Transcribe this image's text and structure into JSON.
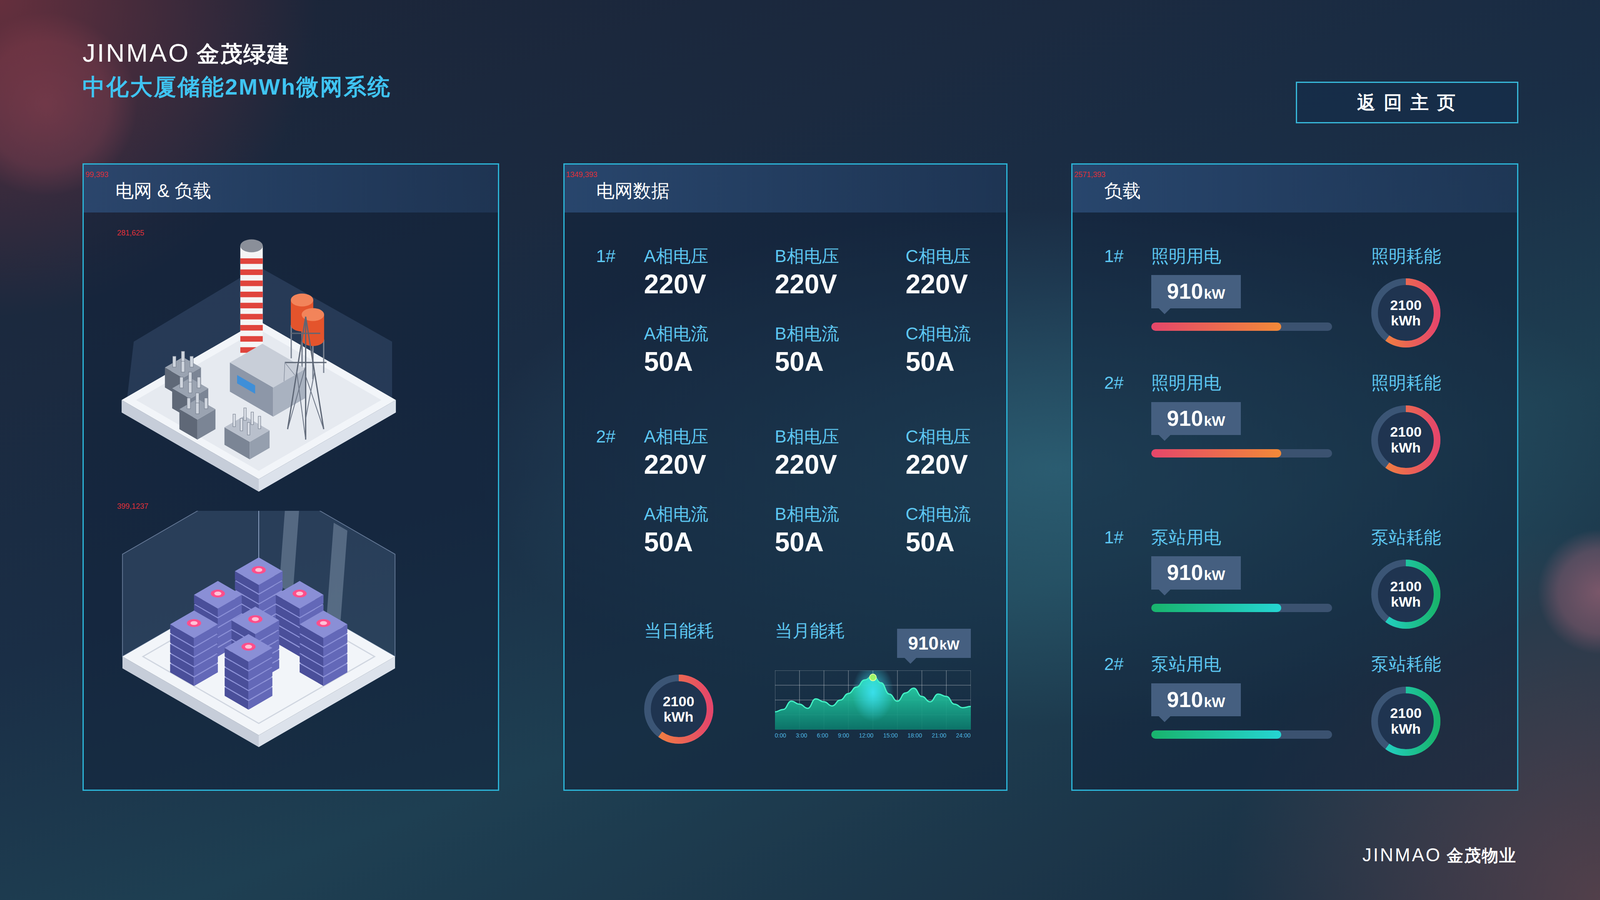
{
  "header": {
    "logo": {
      "brand": "JINMAO",
      "name": "金茂绿建"
    },
    "title": "中化大厦储能2MWh微网系统",
    "home_button": "返 回 主 页"
  },
  "panels": {
    "grid_load": {
      "title": "电网 & 负载",
      "annotation": "99,393",
      "figures": [
        {
          "kind": "substation",
          "annotation": "281,625"
        },
        {
          "kind": "battery",
          "annotation": "399,1237"
        }
      ]
    },
    "grid_data": {
      "title": "电网数据",
      "annotation": "1349,393",
      "groups": [
        {
          "id": "1#",
          "metrics": [
            {
              "label": "A相电压",
              "value": "220V"
            },
            {
              "label": "B相电压",
              "value": "220V"
            },
            {
              "label": "C相电压",
              "value": "220V"
            },
            {
              "label": "A相电流",
              "value": "50A"
            },
            {
              "label": "B相电流",
              "value": "50A"
            },
            {
              "label": "C相电流",
              "value": "50A"
            }
          ]
        },
        {
          "id": "2#",
          "metrics": [
            {
              "label": "A相电压",
              "value": "220V"
            },
            {
              "label": "B相电压",
              "value": "220V"
            },
            {
              "label": "C相电压",
              "value": "220V"
            },
            {
              "label": "A相电流",
              "value": "50A"
            },
            {
              "label": "B相电流",
              "value": "50A"
            },
            {
              "label": "C相电流",
              "value": "50A"
            }
          ]
        }
      ],
      "daily": {
        "label": "当日能耗",
        "value": "2100",
        "unit": "kWh",
        "level": 0.6
      },
      "monthly": {
        "label": "当月能耗",
        "tooltip": {
          "value": "910",
          "unit": "kW"
        },
        "x_ticks": [
          "0:00",
          "3:00",
          "6:00",
          "9:00",
          "12:00",
          "15:00",
          "18:00",
          "21:00",
          "24:00"
        ],
        "series": [
          300,
          340,
          480,
          430,
          360,
          520,
          470,
          400,
          500,
          610,
          720,
          840,
          910,
          790,
          600,
          480,
          620,
          700,
          560,
          470,
          600,
          560,
          430,
          370,
          390
        ]
      }
    },
    "load": {
      "title": "负载",
      "annotation": "2571,393",
      "rows": [
        {
          "id": "1#",
          "label": "照明用电",
          "value": "910",
          "unit": "kW",
          "level": 0.72,
          "kind": "lighting",
          "gauge": {
            "label": "照明耗能",
            "value": "2100",
            "unit": "kWh",
            "level": 0.6
          }
        },
        {
          "id": "2#",
          "label": "照明用电",
          "value": "910",
          "unit": "kW",
          "level": 0.72,
          "kind": "lighting",
          "gauge": {
            "label": "照明耗能",
            "value": "2100",
            "unit": "kWh",
            "level": 0.6
          }
        },
        {
          "id": "1#",
          "label": "泵站用电",
          "value": "910",
          "unit": "kW",
          "level": 0.72,
          "kind": "pump",
          "gauge": {
            "label": "泵站耗能",
            "value": "2100",
            "unit": "kWh",
            "level": 0.6
          }
        },
        {
          "id": "2#",
          "label": "泵站用电",
          "value": "910",
          "unit": "kW",
          "level": 0.72,
          "kind": "pump",
          "gauge": {
            "label": "泵站耗能",
            "value": "2100",
            "unit": "kWh",
            "level": 0.6
          }
        }
      ]
    }
  },
  "footer": {
    "logo": {
      "brand": "JINMAO",
      "name": "金茂物业"
    }
  }
}
